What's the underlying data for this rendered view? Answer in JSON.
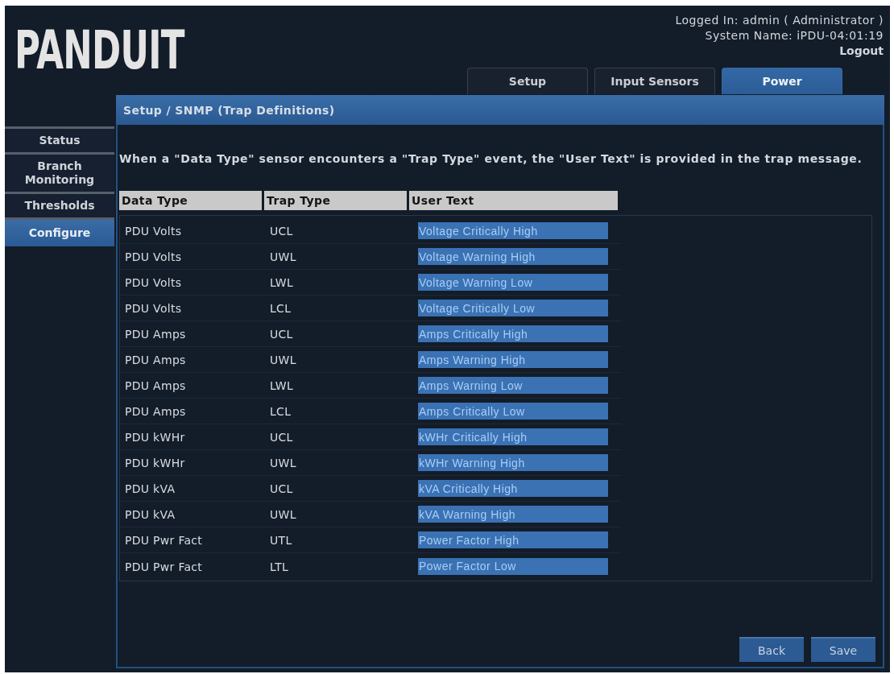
{
  "header": {
    "logo": "PANDUIT",
    "logged_in": "Logged In: admin ( Administrator )",
    "system_name": "System Name: iPDU-04:01:19",
    "logout": "Logout"
  },
  "tabs": [
    {
      "label": "Setup",
      "selected": false
    },
    {
      "label": "Input Sensors",
      "selected": false
    },
    {
      "label": "Power",
      "selected": true
    }
  ],
  "sidebar": {
    "items": [
      {
        "label": "Status",
        "selected": false
      },
      {
        "label": "Branch Monitoring",
        "selected": false
      },
      {
        "label": "Thresholds",
        "selected": false
      },
      {
        "label": "Configure",
        "selected": true
      }
    ]
  },
  "panel": {
    "title": "Setup / SNMP (Trap Definitions)",
    "description": "When a \"Data Type\" sensor encounters a \"Trap Type\" event, the \"User Text\" is provided in the trap message.",
    "table": {
      "columns": [
        "Data Type",
        "Trap Type",
        "User Text"
      ],
      "rows": [
        {
          "data_type": "PDU Volts",
          "trap_type": "UCL",
          "user_text": "Voltage Critically High"
        },
        {
          "data_type": "PDU Volts",
          "trap_type": "UWL",
          "user_text": "Voltage Warning High"
        },
        {
          "data_type": "PDU Volts",
          "trap_type": "LWL",
          "user_text": "Voltage Warning Low"
        },
        {
          "data_type": "PDU Volts",
          "trap_type": "LCL",
          "user_text": "Voltage Critically Low"
        },
        {
          "data_type": "PDU Amps",
          "trap_type": "UCL",
          "user_text": "Amps Critically High"
        },
        {
          "data_type": "PDU Amps",
          "trap_type": "UWL",
          "user_text": "Amps Warning High"
        },
        {
          "data_type": "PDU Amps",
          "trap_type": "LWL",
          "user_text": "Amps Warning Low"
        },
        {
          "data_type": "PDU Amps",
          "trap_type": "LCL",
          "user_text": "Amps Critically Low"
        },
        {
          "data_type": "PDU kWHr",
          "trap_type": "UCL",
          "user_text": "kWHr Critically High"
        },
        {
          "data_type": "PDU kWHr",
          "trap_type": "UWL",
          "user_text": "kWHr Warning High"
        },
        {
          "data_type": "PDU kVA",
          "trap_type": "UCL",
          "user_text": "kVA Critically High"
        },
        {
          "data_type": "PDU kVA",
          "trap_type": "UWL",
          "user_text": "kVA Warning High"
        },
        {
          "data_type": "PDU Pwr Fact",
          "trap_type": "UTL",
          "user_text": "Power Factor High"
        },
        {
          "data_type": "PDU Pwr Fact",
          "trap_type": "LTL",
          "user_text": "Power Factor Low"
        }
      ]
    }
  },
  "buttons": [
    {
      "label": "Back"
    },
    {
      "label": "Save"
    }
  ]
}
